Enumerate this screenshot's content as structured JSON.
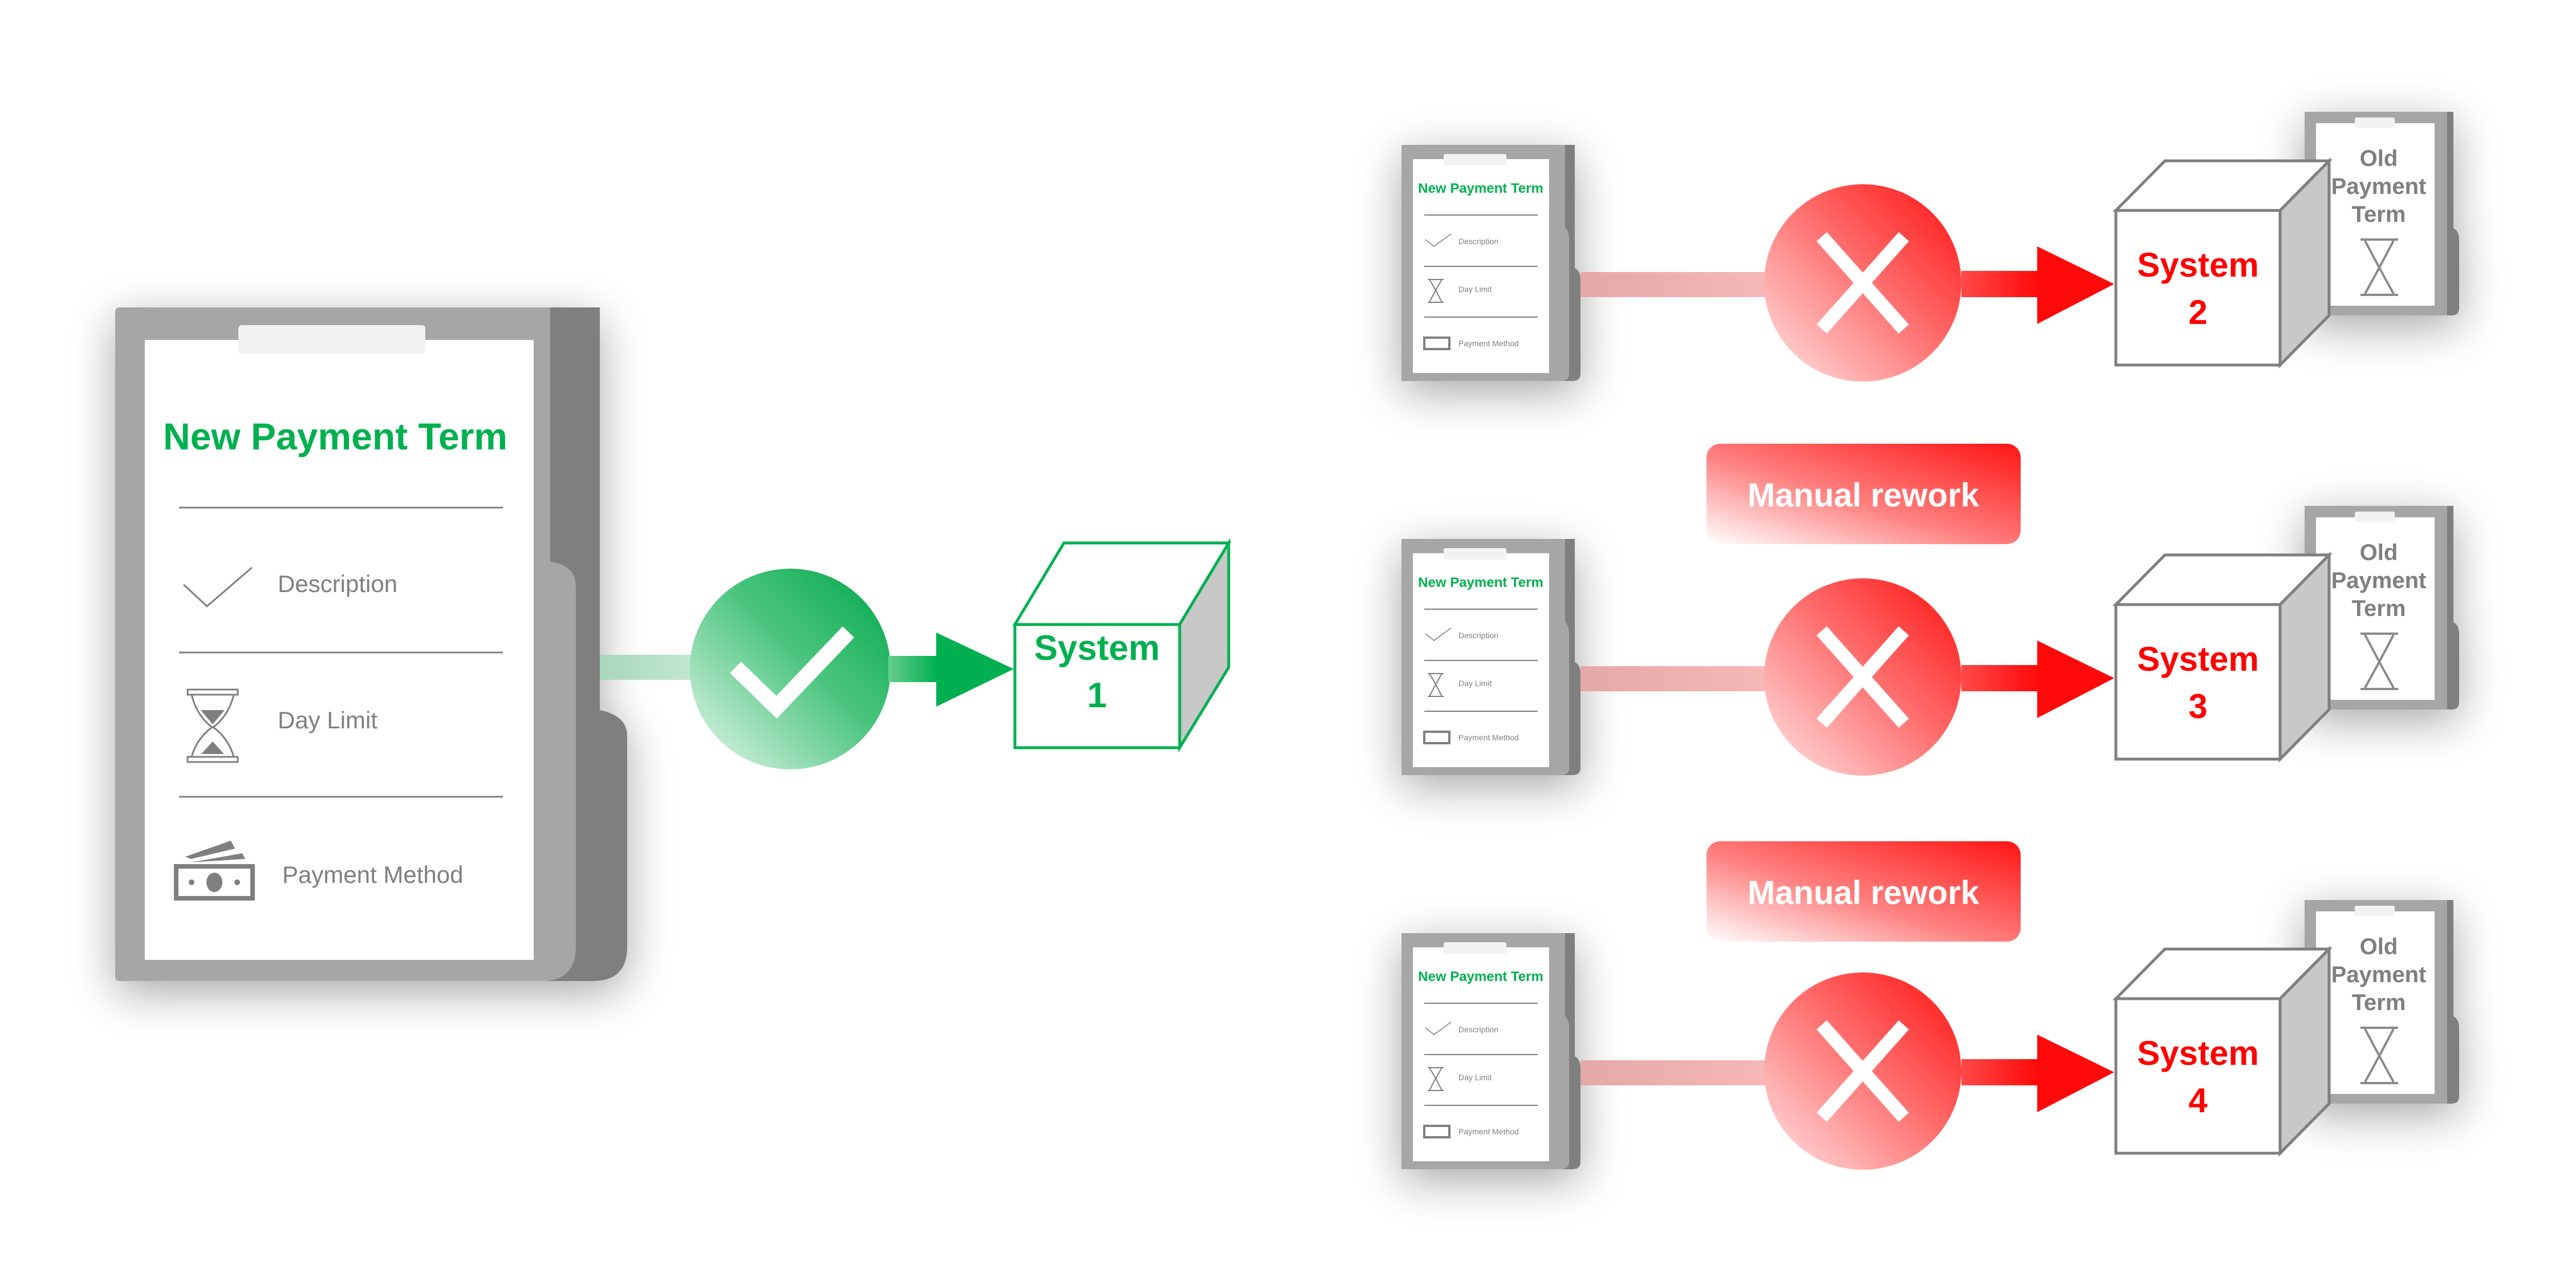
{
  "colors": {
    "green": "#00b050",
    "red": "#ff0000",
    "folder_light": "#a6a6a6",
    "folder_dark": "#7f7f7f",
    "text_gray": "#7f7f7f"
  },
  "main_term": {
    "title": "New Payment Term",
    "items": [
      {
        "label": "Description",
        "icon": "checkmark-icon"
      },
      {
        "label": "Day Limit",
        "icon": "hourglass-icon"
      },
      {
        "label": "Payment Method",
        "icon": "banknote-icon"
      }
    ]
  },
  "success_path": {
    "status_icon": "check-circle-icon",
    "system_label": "System",
    "system_number": "1"
  },
  "failure_rows": [
    {
      "term_title": "New Payment Term",
      "items": [
        "Description",
        "Day Limit",
        "Payment Method"
      ],
      "status_icon": "x-circle-icon",
      "system_label": "System",
      "system_number": "2",
      "old_term": [
        "Old",
        "Payment",
        "Term"
      ]
    },
    {
      "term_title": "New Payment Term",
      "items": [
        "Description",
        "Day Limit",
        "Payment Method"
      ],
      "status_icon": "x-circle-icon",
      "system_label": "System",
      "system_number": "3",
      "old_term": [
        "Old",
        "Payment",
        "Term"
      ]
    },
    {
      "term_title": "New Payment Term",
      "items": [
        "Description",
        "Day Limit",
        "Payment Method"
      ],
      "status_icon": "x-circle-icon",
      "system_label": "System",
      "system_number": "4",
      "old_term": [
        "Old",
        "Payment",
        "Term"
      ]
    }
  ],
  "manual_rework": [
    "Manual rework",
    "Manual rework"
  ]
}
